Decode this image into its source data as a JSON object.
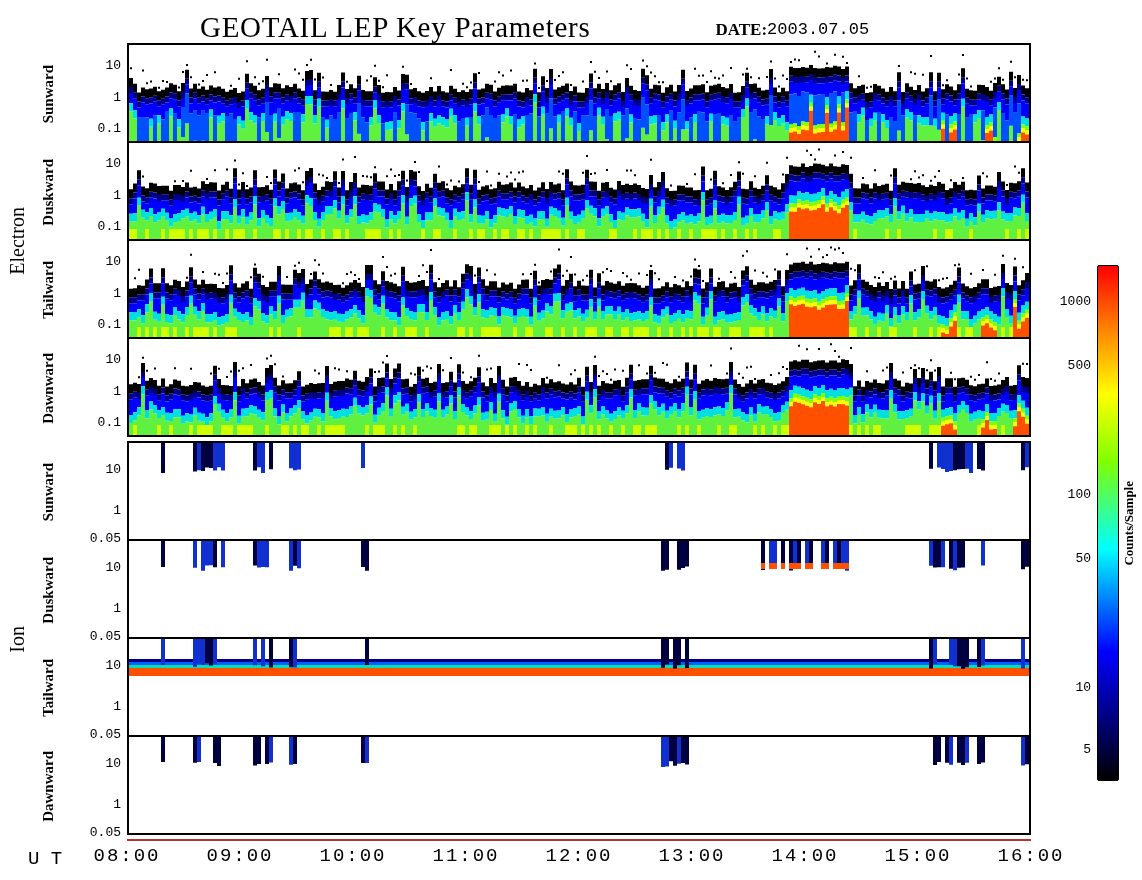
{
  "title": "GEOTAIL LEP Key Parameters",
  "date": {
    "label": "DATE:",
    "value": "2003.07.05"
  },
  "groups": [
    {
      "label": "Electron",
      "kind": "electron",
      "panels": [
        {
          "label": "Sunward",
          "yticks": [
            "10",
            "1",
            "0.1"
          ]
        },
        {
          "label": "Duskward",
          "yticks": [
            "10",
            "1",
            "0.1"
          ]
        },
        {
          "label": "Tailward",
          "yticks": [
            "10",
            "1",
            "0.1"
          ]
        },
        {
          "label": "Dawnward",
          "yticks": [
            "10",
            "1",
            "0.1"
          ]
        }
      ]
    },
    {
      "label": "Ion",
      "kind": "ion",
      "panels": [
        {
          "label": "Sunward",
          "yticks": [
            "10",
            "1",
            "0.05"
          ]
        },
        {
          "label": "Duskward",
          "yticks": [
            "10",
            "1",
            "0.05"
          ]
        },
        {
          "label": "Tailward",
          "yticks": [
            "10",
            "1",
            "0.05"
          ]
        },
        {
          "label": "Dawnward",
          "yticks": [
            "10",
            "1",
            "0.05"
          ]
        }
      ]
    }
  ],
  "colorbar": {
    "label": "Counts/Sample",
    "ticks": [
      "1000",
      "500",
      "100",
      "50",
      "10",
      "5"
    ]
  },
  "x_axis": {
    "label": "U T",
    "ticks": [
      "08:00",
      "09:00",
      "10:00",
      "11:00",
      "12:00",
      "13:00",
      "14:00",
      "15:00",
      "16:00"
    ]
  }
}
